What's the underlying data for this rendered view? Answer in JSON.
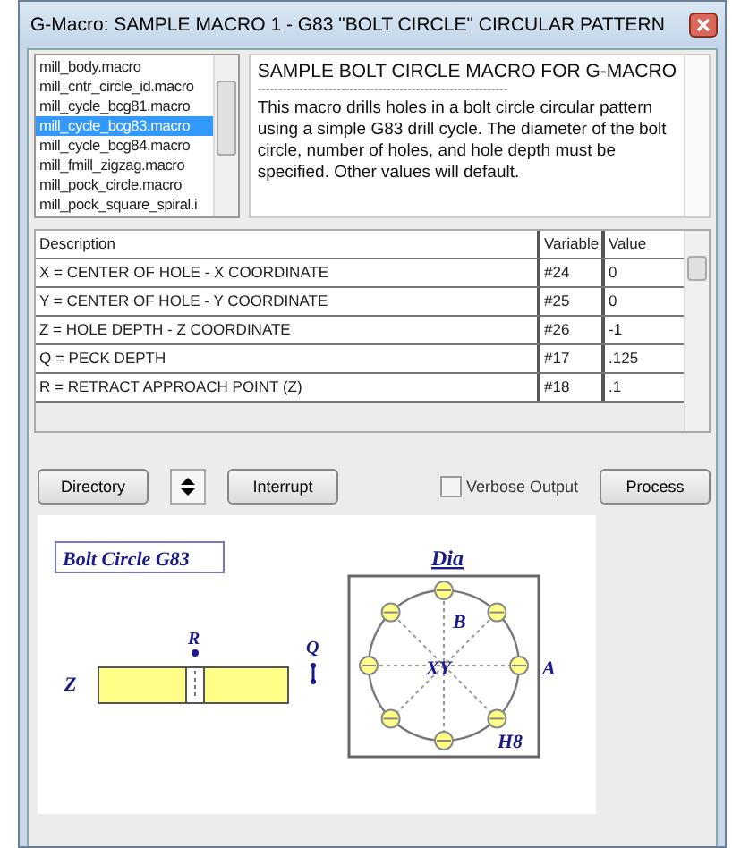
{
  "window": {
    "title": "G-Macro:  SAMPLE MACRO 1 - G83 \"BOLT CIRCLE\" CIRCULAR PATTERN"
  },
  "macro_list": {
    "items": [
      {
        "label": "mill_body.macro",
        "selected": false
      },
      {
        "label": "mill_cntr_circle_id.macro",
        "selected": false
      },
      {
        "label": "mill_cycle_bcg81.macro",
        "selected": false
      },
      {
        "label": "mill_cycle_bcg83.macro",
        "selected": true
      },
      {
        "label": "mill_cycle_bcg84.macro",
        "selected": false
      },
      {
        "label": "mill_fmill_zigzag.macro",
        "selected": false
      },
      {
        "label": "mill_pock_circle.macro",
        "selected": false
      },
      {
        "label": "mill_pock_square_spiral.i",
        "selected": false
      }
    ]
  },
  "description": {
    "heading": "SAMPLE BOLT CIRCLE MACRO FOR G-MACRO",
    "separator": "------------------------------------------------------------",
    "body": "This macro drills holes in a bolt circle circular pattern using a simple G83 drill cycle. The diameter of the bolt circle, number of holes, and hole depth must be specified. Other values will default."
  },
  "table": {
    "columns": [
      "Description",
      "Variable",
      "Value"
    ],
    "rows": [
      [
        "X = CENTER OF HOLE - X COORDINATE",
        "#24",
        "0"
      ],
      [
        "Y = CENTER OF HOLE - Y COORDINATE",
        "#25",
        "0"
      ],
      [
        "Z = HOLE DEPTH - Z COORDINATE",
        "#26",
        "-1"
      ],
      [
        "Q = PECK DEPTH",
        "#17",
        ".125"
      ],
      [
        "R = RETRACT APPROACH POINT (Z)",
        "#18",
        ".1"
      ]
    ]
  },
  "buttons": {
    "directory": "Directory",
    "interrupt": "Interrupt",
    "process": "Process"
  },
  "verbose": {
    "label": "Verbose Output",
    "checked": false
  },
  "diagram": {
    "title": "Bolt Circle G83",
    "dia": "Dia",
    "r": "R",
    "q": "Q",
    "z": "Z",
    "b": "B",
    "xy": "XY",
    "a": "A",
    "holes": "H8"
  }
}
